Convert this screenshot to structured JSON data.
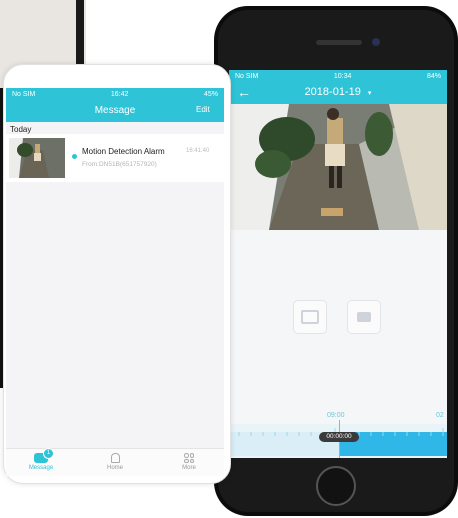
{
  "right_phone": {
    "status": {
      "carrier": "No SIM",
      "time": "10:34",
      "battery": "84%"
    },
    "nav": {
      "back_icon": "arrow-left-icon",
      "date": "2018-01-19",
      "chevron": "▾"
    },
    "timeline": {
      "label_left": "09:00",
      "label_right": "02",
      "current_time": "00:00:00"
    }
  },
  "left_phone": {
    "status": {
      "carrier": "No SIM",
      "time": "16:42",
      "battery": "45%"
    },
    "header": {
      "title": "Message",
      "edit_label": "Edit"
    },
    "section_label": "Today",
    "message": {
      "title": "Motion Detection Alarm",
      "time": "16:41:40",
      "from": "From:DN51B(651757920)"
    },
    "tabs": [
      {
        "label": "Message",
        "badge": "1"
      },
      {
        "label": "Home"
      },
      {
        "label": "More"
      }
    ]
  },
  "colors": {
    "accent": "#2ec3d6",
    "timeline": "#2fb7e8",
    "needle": "#f0a040"
  }
}
